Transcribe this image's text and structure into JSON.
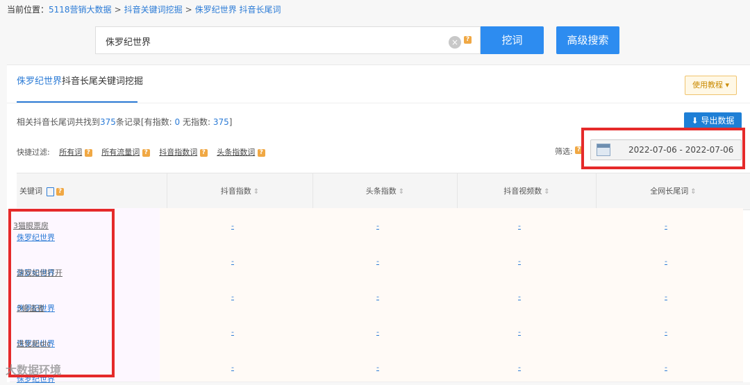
{
  "breadcrumb": {
    "prefix": "当前位置：",
    "items": [
      "5118营销大数据",
      "抖音关键词挖掘",
      "侏罗纪世界 抖音长尾词"
    ],
    "sep": ">"
  },
  "search": {
    "value": "侏罗纪世界",
    "clear_icon": "×",
    "help": "?",
    "dig_button": "挖词",
    "advanced_button": "高级搜索"
  },
  "panel": {
    "title_highlight": "侏罗纪世界",
    "title_rest": "抖音长尾关键词挖掘",
    "tutorial_button": "使用教程 ▾",
    "stats": {
      "prefix": "相关抖音长尾词共找到",
      "total": "375",
      "middle": "条记录[有指数:",
      "with_index": "0",
      "no_index_label": "无指数:",
      "no_index": "375",
      "suffix": "]"
    },
    "export_button": "⬇ 导出数据",
    "quick_filter_label": "快捷过滤:",
    "filters": [
      "所有词",
      "所有流量词",
      "抖音指数词",
      "头条指数词"
    ],
    "filter_label": "筛选:",
    "date_range": "2022-07-06 - 2022-07-06",
    "accent_color": "#2d8cf0",
    "highlight_color": "#e52a2a"
  },
  "table": {
    "columns": [
      "关键词",
      "抖音指数",
      "头条指数",
      "抖音视频数",
      "全网长尾词"
    ],
    "sort_icon": "⇕",
    "rows": [
      {
        "kw_blue": "侏罗纪世界",
        "kw_gray": "3猫眼票房",
        "vals": [
          "-",
          "-",
          "-",
          "-"
        ]
      },
      {
        "kw_blue": "侏罗纪世界",
        "kw_gray": "游戏如何打开",
        "vals": [
          "-",
          "-",
          "-",
          "-"
        ]
      },
      {
        "kw_blue": "侏罗纪世界",
        "kw_gray": "3偷盗者",
        "vals": [
          "-",
          "-",
          "-",
          "-"
        ]
      },
      {
        "kw_blue": "侏罗纪世界",
        "kw_gray": "进化新dlc",
        "vals": [
          "-",
          "-",
          "-",
          "-"
        ]
      },
      {
        "kw_blue": "侏罗纪世界",
        "kw_gray": "",
        "vals": [
          "-",
          "-",
          "-",
          "-"
        ]
      }
    ]
  },
  "watermark": "大数据环境"
}
